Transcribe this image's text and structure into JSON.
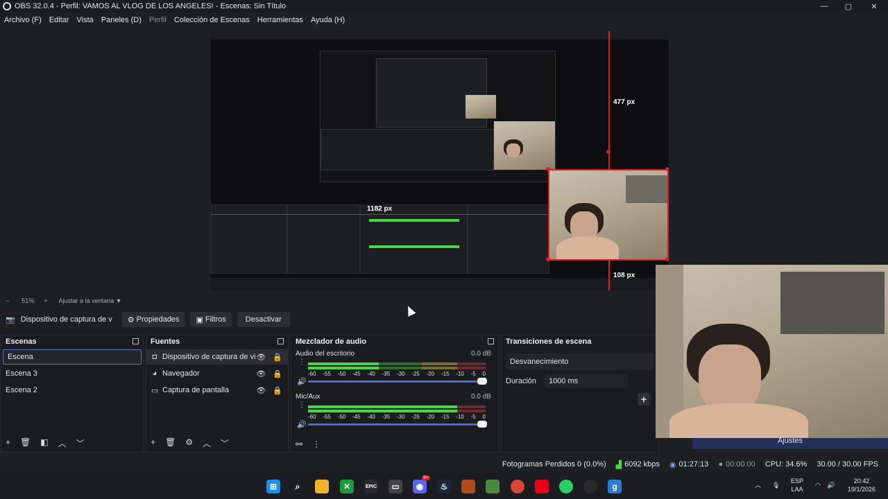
{
  "window": {
    "title": "OBS 32.0.4 - Perfil: VAMOS AL VLOG DE LOS ANGELES! - Escenas: Sin Título",
    "minimize": "—",
    "maximize": "▢",
    "close": "✕"
  },
  "menu": [
    "Archivo (F)",
    "Editar",
    "Vista",
    "Paneles (D)",
    "Perfil",
    "Colección de Escenas",
    "Herramientas",
    "Ayuda (H)"
  ],
  "preview": {
    "measure_top": "477 px",
    "measure_left": "1182 px",
    "measure_bottom": "108 px"
  },
  "zoom": {
    "minus": "−",
    "value": "51%",
    "plus": "+",
    "fit": "Ajustar a la ventana"
  },
  "source_toolbar": {
    "selected_source": "Dispositivo de captura de v",
    "properties": "Propiedades",
    "filters": "Filtros",
    "deactivate": "Desactivar"
  },
  "scenes": {
    "title": "Escenas",
    "items": [
      "Escena",
      "Escena 3",
      "Escena 2"
    ]
  },
  "sources": {
    "title": "Fuentes",
    "items": [
      {
        "label": "Dispositivo de captura de vi",
        "icon": "camera-icon"
      },
      {
        "label": "Navegador",
        "icon": "globe-icon"
      },
      {
        "label": "Captura de pantalla",
        "icon": "monitor-icon"
      }
    ]
  },
  "mixer": {
    "title": "Mezclador de audio",
    "channels": [
      {
        "name": "Audio del escritorio",
        "db": "0.0 dB",
        "level": 0.4
      },
      {
        "name": "Mic/Aux",
        "db": "0.0 dB",
        "level": 0.84
      }
    ],
    "ticks": [
      "-60",
      "-55",
      "-50",
      "-45",
      "-40",
      "-35",
      "-30",
      "-25",
      "-20",
      "-15",
      "-10",
      "-5",
      "0"
    ]
  },
  "transitions": {
    "title": "Transiciones de escena",
    "type": "Desvanecimiento",
    "duration_label": "Duración",
    "duration_value": "1000 ms",
    "add": "+",
    "settings": "Ajustes"
  },
  "status": {
    "dropped": "Fotogramas Perdidos 0 (0.0%)",
    "bitrate": "6092 kbps",
    "stream_time": "01:27:13",
    "rec_time": "00:00:00",
    "cpu": "CPU: 34.6%",
    "fps": "30.00 / 30.00 FPS"
  },
  "taskbar": {
    "lang_top": "ESP",
    "lang_bottom": "LAA",
    "time": "20:42",
    "date": "19/1/2026",
    "discord_badge": "9+"
  }
}
